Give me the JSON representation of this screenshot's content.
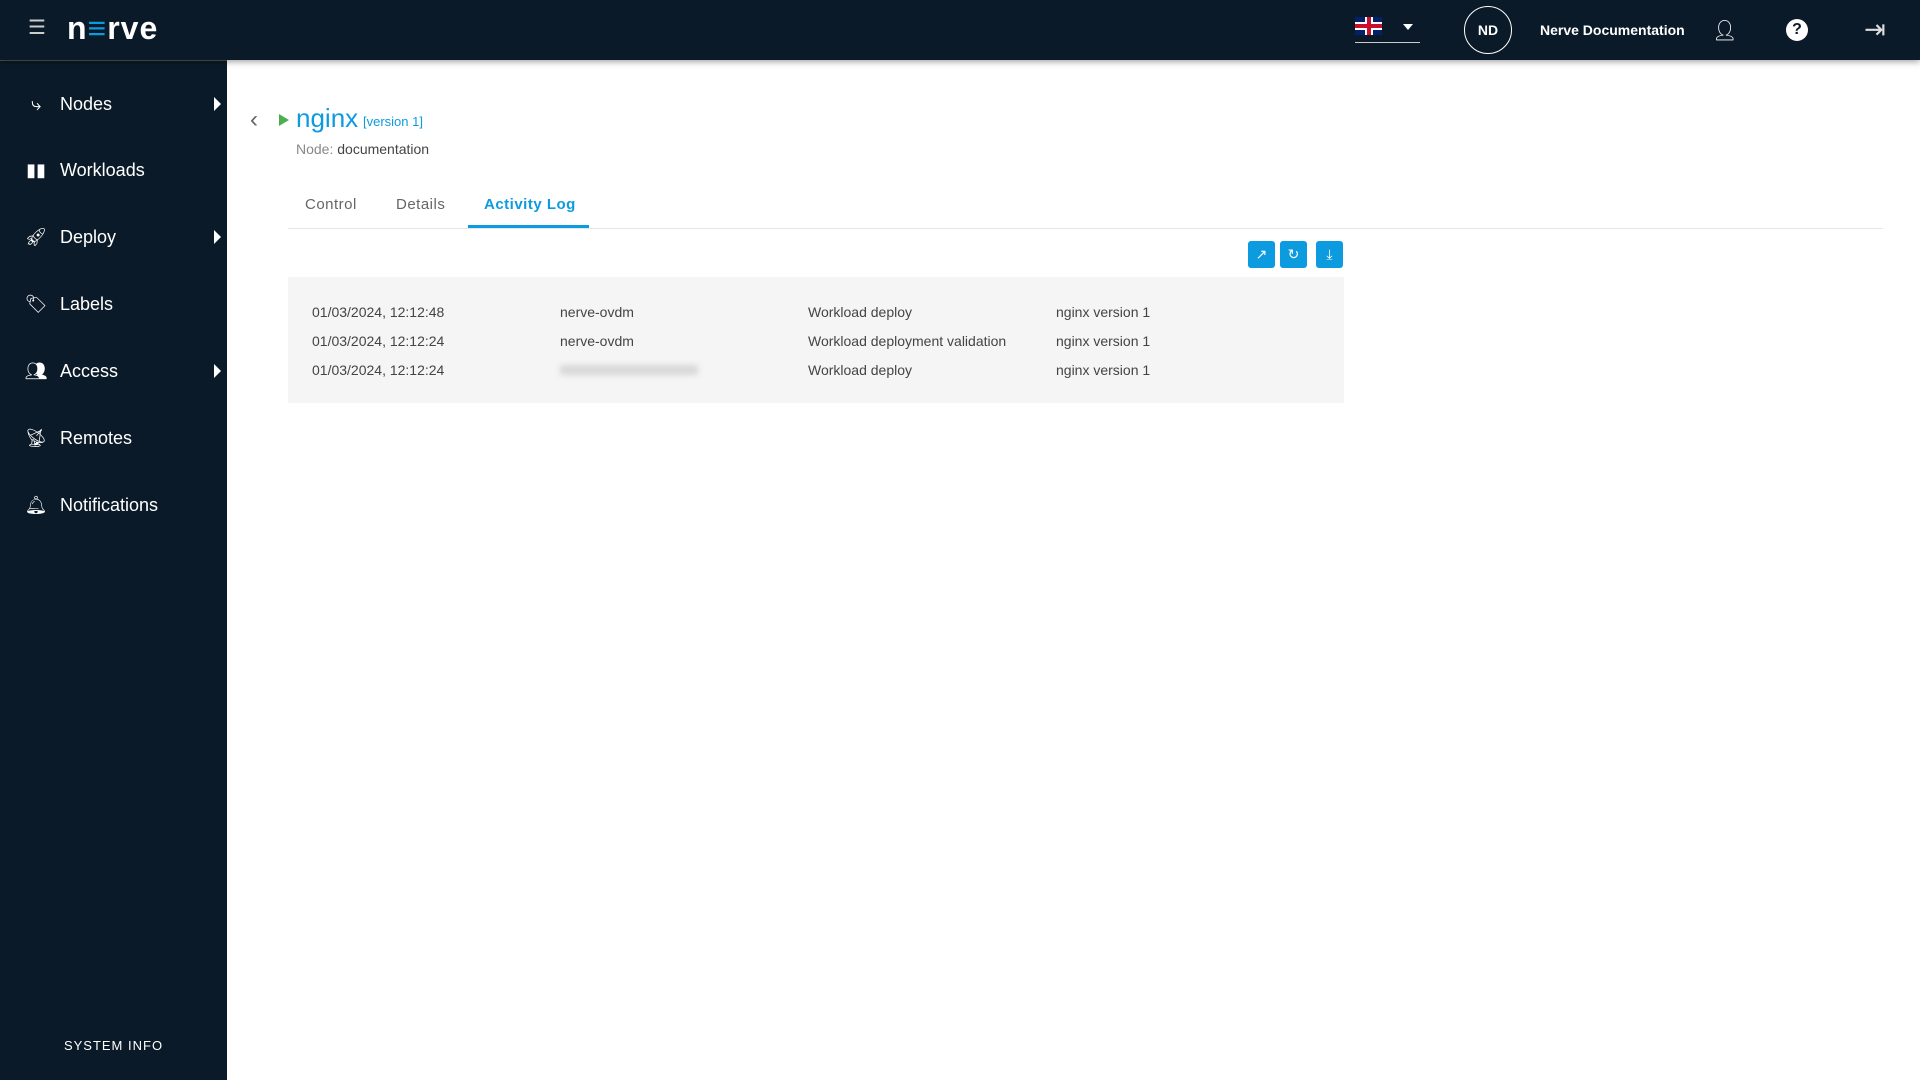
{
  "header": {
    "logo": "nerve",
    "initials": "ND",
    "user_name": "Nerve Documentation",
    "language": "en-GB"
  },
  "sidebar": {
    "items": [
      {
        "label": "Nodes",
        "icon": "nodes-icon",
        "has_submenu": true
      },
      {
        "label": "Workloads",
        "icon": "workloads-icon",
        "has_submenu": false
      },
      {
        "label": "Deploy",
        "icon": "rocket-icon",
        "has_submenu": true
      },
      {
        "label": "Labels",
        "icon": "label-icon",
        "has_submenu": false
      },
      {
        "label": "Access",
        "icon": "users-icon",
        "has_submenu": true
      },
      {
        "label": "Remotes",
        "icon": "remotes-icon",
        "has_submenu": false
      },
      {
        "label": "Notifications",
        "icon": "bell-icon",
        "has_submenu": false
      }
    ],
    "system_info": "SYSTEM INFO"
  },
  "workload": {
    "name": "nginx",
    "version": "[version 1]",
    "node_label": "Node:",
    "node": "documentation",
    "status_color": "#4caf50"
  },
  "tabs": [
    "Control",
    "Details",
    "Activity Log"
  ],
  "active_tab": "Activity Log",
  "accent": "#0d9be0",
  "log": [
    {
      "time": "01/03/2024, 12:12:48",
      "user": "nerve-ovdm",
      "action": "Workload deploy",
      "target": "nginx version 1"
    },
    {
      "time": "01/03/2024, 12:12:24",
      "user": "nerve-ovdm",
      "action": "Workload deployment validation",
      "target": "nginx version 1"
    },
    {
      "time": "01/03/2024, 12:12:24",
      "user": "",
      "action": "Workload deploy",
      "target": "nginx version 1"
    }
  ]
}
